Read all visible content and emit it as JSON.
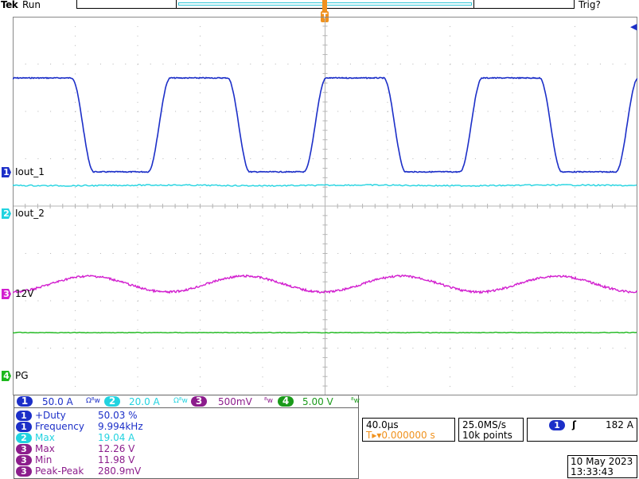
{
  "status": {
    "brand": "Tek",
    "run": "Run",
    "trigger": "Trig?"
  },
  "trigger_marker": "T",
  "colors": {
    "ch1": "#1c2fc8",
    "ch2": "#22d3e0",
    "ch3": "#d21fcf",
    "ch4": "#1db81d",
    "trigger": "#f0921e",
    "grid": "#b4b4b4"
  },
  "channels": [
    {
      "num": "1",
      "label": "Iout_1"
    },
    {
      "num": "2",
      "label": "Iout_2"
    },
    {
      "num": "3",
      "label": "12V"
    },
    {
      "num": "4",
      "label": "PG"
    }
  ],
  "scales": [
    {
      "num": "1",
      "value": "50.0 A",
      "suffix": "Ω⁸w"
    },
    {
      "num": "2",
      "value": "20.0 A",
      "suffix": "Ω⁸w"
    },
    {
      "num": "3",
      "value": "500mV",
      "suffix": "⁸w"
    },
    {
      "num": "4",
      "value": "5.00 V",
      "suffix": "⁸w"
    }
  ],
  "measurements": [
    {
      "ch": "1",
      "name": "+Duty",
      "value": "50.03 %"
    },
    {
      "ch": "1",
      "name": "Frequency",
      "value": "9.994kHz"
    },
    {
      "ch": "2",
      "name": "Max",
      "value": "19.04 A"
    },
    {
      "ch": "3",
      "name": "Max",
      "value": "12.26 V"
    },
    {
      "ch": "3",
      "name": "Min",
      "value": "11.98 V"
    },
    {
      "ch": "3",
      "name": "Peak-Peak",
      "value": "280.9mV"
    }
  ],
  "timebase": {
    "scale": "40.0µs",
    "trig_pos": "T▸▾0.000000 s"
  },
  "acquisition": {
    "rate": "25.0MS/s",
    "points": "10k points"
  },
  "trigger": {
    "source": "1",
    "slope": "ʃ",
    "level": "182 A"
  },
  "datetime": {
    "date": "10 May 2023",
    "time": "13:33:43"
  }
}
